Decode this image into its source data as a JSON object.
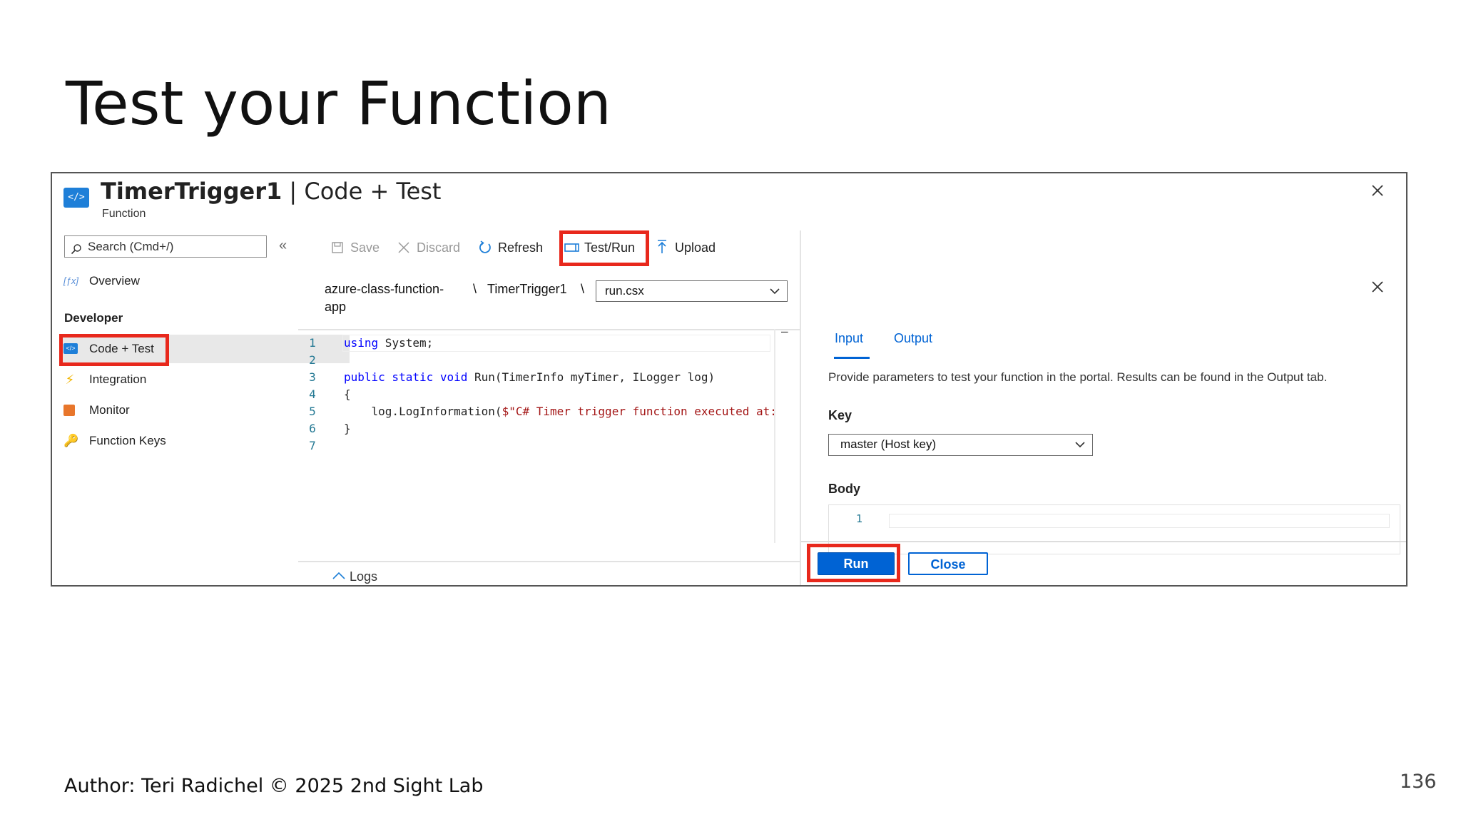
{
  "slide": {
    "title": "Test your Function",
    "footer": "Author: Teri Radichel © 2025 2nd Sight Lab",
    "page_number": "136"
  },
  "header": {
    "name": "TimerTrigger1",
    "separator": " | ",
    "section": "Code + Test",
    "subtitle": "Function",
    "more": "···"
  },
  "sidebar": {
    "search_placeholder": "Search (Cmd+/)",
    "collapse": "«",
    "overview": "Overview",
    "section_developer": "Developer",
    "items": [
      {
        "label": "Code + Test",
        "icon": "code-icon"
      },
      {
        "label": "Integration",
        "icon": "lightning-icon"
      },
      {
        "label": "Monitor",
        "icon": "monitor-icon"
      },
      {
        "label": "Function Keys",
        "icon": "key-icon"
      }
    ]
  },
  "toolbar": {
    "save": "Save",
    "discard": "Discard",
    "refresh": "Refresh",
    "test_run": "Test/Run",
    "upload": "Upload"
  },
  "breadcrumb": {
    "app_line1": "azure-class-function-",
    "app_line2": "app",
    "sep1": "\\",
    "function": "TimerTrigger1",
    "sep2": "\\",
    "file": "run.csx"
  },
  "editor": {
    "line_numbers": [
      "1",
      "2",
      "3",
      "4",
      "5",
      "6",
      "7"
    ],
    "l1_kw": "using",
    "l1_rest": " System;",
    "l3_kw": "public static void",
    "l3_rest": " Run(TimerInfo myTimer, ILogger log)",
    "l4": "{",
    "l5_pre": "    log.LogInformation(",
    "l5_str": "$\"C# Timer trigger function executed at:",
    "l6": "}",
    "minimize": "—"
  },
  "logs": {
    "label": "Logs"
  },
  "test_pane": {
    "tab_input": "Input",
    "tab_output": "Output",
    "description": "Provide parameters to test your function in the portal. Results can be found in the Output tab.",
    "key_label": "Key",
    "key_value": "master (Host key)",
    "body_label": "Body",
    "body_line": "1",
    "run": "Run",
    "close": "Close"
  },
  "colors": {
    "accent": "#0063d4",
    "highlight": "#e8281c"
  }
}
